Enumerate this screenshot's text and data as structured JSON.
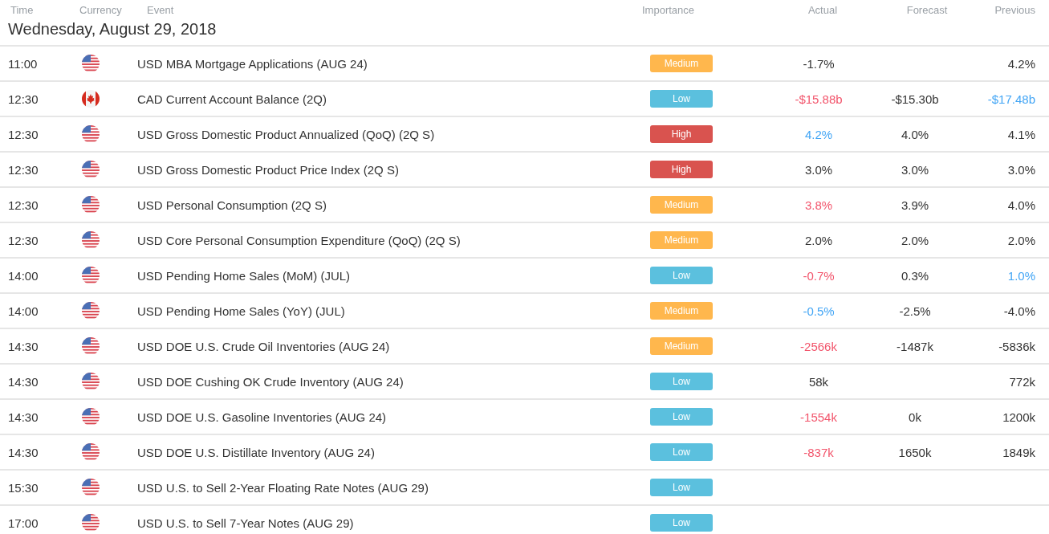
{
  "columns": {
    "time": "Time",
    "currency": "Currency",
    "event": "Event",
    "importance": "Importance",
    "actual": "Actual",
    "forecast": "Forecast",
    "previous": "Previous"
  },
  "date": "Wednesday, August 29, 2018",
  "rows": [
    {
      "time": "11:00",
      "flag": {
        "kind": "us"
      },
      "event": "USD MBA Mortgage Applications (AUG 24)",
      "badge": {
        "text": "Medium",
        "kind": "medium"
      },
      "actual": {
        "text": "-1.7%",
        "kind": "neutral"
      },
      "previous": {
        "text": "4.2%",
        "kind": "neutral"
      }
    },
    {
      "time": "12:30",
      "flag": {
        "kind": "ca"
      },
      "event": "CAD Current Account Balance (2Q)",
      "badge": {
        "text": "Low",
        "kind": "low"
      },
      "actual": {
        "text": "-$15.88b",
        "kind": "negative"
      },
      "forecast": "-$15.30b",
      "previous": {
        "text": "-$17.48b",
        "kind": "positive"
      }
    },
    {
      "time": "12:30",
      "flag": {
        "kind": "us"
      },
      "event": "USD Gross Domestic Product Annualized (QoQ) (2Q S)",
      "badge": {
        "text": "High",
        "kind": "high"
      },
      "actual": {
        "text": "4.2%",
        "kind": "positive"
      },
      "forecast": "4.0%",
      "previous": {
        "text": "4.1%",
        "kind": "neutral"
      }
    },
    {
      "time": "12:30",
      "flag": {
        "kind": "us"
      },
      "event": "USD Gross Domestic Product Price Index (2Q S)",
      "badge": {
        "text": "High",
        "kind": "high"
      },
      "actual": {
        "text": "3.0%",
        "kind": "neutral"
      },
      "forecast": "3.0%",
      "previous": {
        "text": "3.0%",
        "kind": "neutral"
      }
    },
    {
      "time": "12:30",
      "flag": {
        "kind": "us"
      },
      "event": "USD Personal Consumption (2Q S)",
      "badge": {
        "text": "Medium",
        "kind": "medium"
      },
      "actual": {
        "text": "3.8%",
        "kind": "negative"
      },
      "forecast": "3.9%",
      "previous": {
        "text": "4.0%",
        "kind": "neutral"
      }
    },
    {
      "time": "12:30",
      "flag": {
        "kind": "us"
      },
      "event": "USD Core Personal Consumption Expenditure (QoQ) (2Q S)",
      "badge": {
        "text": "Medium",
        "kind": "medium"
      },
      "actual": {
        "text": "2.0%",
        "kind": "neutral"
      },
      "forecast": "2.0%",
      "previous": {
        "text": "2.0%",
        "kind": "neutral"
      }
    },
    {
      "time": "14:00",
      "flag": {
        "kind": "us"
      },
      "event": "USD Pending Home Sales (MoM) (JUL)",
      "badge": {
        "text": "Low",
        "kind": "low"
      },
      "actual": {
        "text": "-0.7%",
        "kind": "negative"
      },
      "forecast": "0.3%",
      "previous": {
        "text": "1.0%",
        "kind": "positive"
      }
    },
    {
      "time": "14:00",
      "flag": {
        "kind": "us"
      },
      "event": "USD Pending Home Sales (YoY) (JUL)",
      "badge": {
        "text": "Medium",
        "kind": "medium"
      },
      "actual": {
        "text": "-0.5%",
        "kind": "positive"
      },
      "forecast": "-2.5%",
      "previous": {
        "text": "-4.0%",
        "kind": "neutral"
      }
    },
    {
      "time": "14:30",
      "flag": {
        "kind": "us"
      },
      "event": "USD DOE U.S. Crude Oil Inventories (AUG 24)",
      "badge": {
        "text": "Medium",
        "kind": "medium"
      },
      "actual": {
        "text": "-2566k",
        "kind": "negative"
      },
      "forecast": "-1487k",
      "previous": {
        "text": "-5836k",
        "kind": "neutral"
      }
    },
    {
      "time": "14:30",
      "flag": {
        "kind": "us"
      },
      "event": "USD DOE Cushing OK Crude Inventory (AUG 24)",
      "badge": {
        "text": "Low",
        "kind": "low"
      },
      "actual": {
        "text": "58k",
        "kind": "neutral"
      },
      "previous": {
        "text": "772k",
        "kind": "neutral"
      }
    },
    {
      "time": "14:30",
      "flag": {
        "kind": "us"
      },
      "event": "USD DOE U.S. Gasoline Inventories (AUG 24)",
      "badge": {
        "text": "Low",
        "kind": "low"
      },
      "actual": {
        "text": "-1554k",
        "kind": "negative"
      },
      "forecast": "0k",
      "previous": {
        "text": "1200k",
        "kind": "neutral"
      }
    },
    {
      "time": "14:30",
      "flag": {
        "kind": "us"
      },
      "event": "USD DOE U.S. Distillate Inventory (AUG 24)",
      "badge": {
        "text": "Low",
        "kind": "low"
      },
      "actual": {
        "text": "-837k",
        "kind": "negative"
      },
      "forecast": "1650k",
      "previous": {
        "text": "1849k",
        "kind": "neutral"
      }
    },
    {
      "time": "15:30",
      "flag": {
        "kind": "us"
      },
      "event": "USD U.S. to Sell 2-Year Floating Rate Notes (AUG 29)",
      "badge": {
        "text": "Low",
        "kind": "low"
      }
    },
    {
      "time": "17:00",
      "flag": {
        "kind": "us"
      },
      "event": "USD U.S. to Sell 7-Year Notes (AUG 29)",
      "badge": {
        "text": "Low",
        "kind": "low"
      }
    }
  ]
}
